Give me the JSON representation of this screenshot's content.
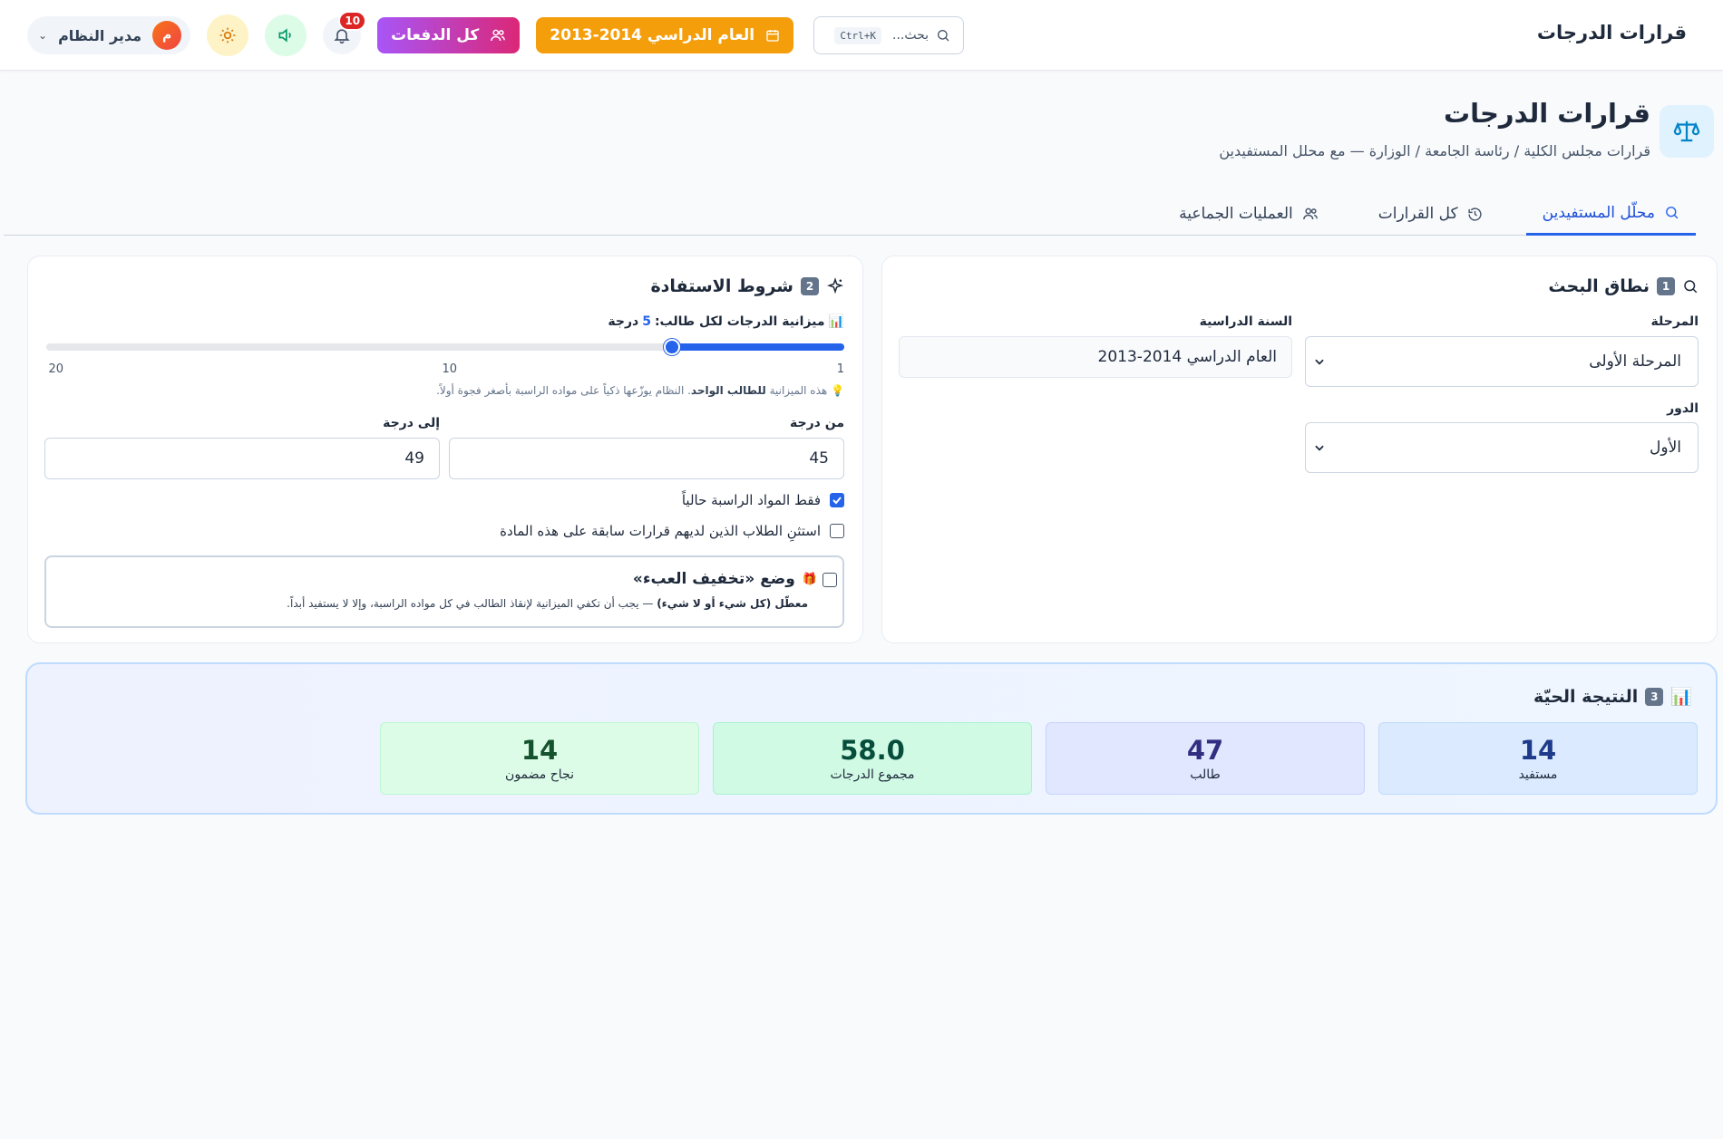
{
  "topbar": {
    "app_title": "قرارات الدرجات",
    "search_placeholder": "بحث...",
    "search_shortcut": "Ctrl+K",
    "year_pill": "العام الدراسي 2014-2013",
    "batches_pill": "كل الدفعات",
    "notifications_count": "10",
    "user_name": "مدير النظام",
    "user_initial": "م"
  },
  "page": {
    "title": "قرارات الدرجات",
    "subtitle": "قرارات مجلس الكلية / رئاسة الجامعة / الوزارة — مع محلل المستفيدين"
  },
  "tabs": [
    {
      "label": "محلّل المستفيدين",
      "icon": "search-icon",
      "active": true
    },
    {
      "label": "كل القرارات",
      "icon": "history-icon",
      "active": false
    },
    {
      "label": "العمليات الجماعية",
      "icon": "users-icon",
      "active": false
    }
  ],
  "scope": {
    "badge": "1",
    "title": "نطاق البحث",
    "stage_label": "المرحلة",
    "stage_value": "المرحلة الأولى",
    "year_label": "السنة الدراسية",
    "year_value": "العام الدراسي 2014-2013",
    "round_label": "الدور",
    "round_value": "الأول"
  },
  "conditions": {
    "badge": "2",
    "title": "شروط الاستفادة",
    "budget_label": "ميزانية الدرجات لكل طالب:",
    "budget_value": "5",
    "budget_unit": "درجة",
    "slider": {
      "min": 1,
      "max": 20,
      "value": 5
    },
    "tick_min": "1",
    "tick_mid": "10",
    "tick_max": "20",
    "hint_prefix": "هذه الميزانية",
    "hint_bold": "للطالب الواحد",
    "hint_suffix": ". النظام يوزّعها ذكياً على مواده الراسبة بأصغر فجوة أولاً.",
    "from_label": "من درجة",
    "from_value": "45",
    "to_label": "إلى درجة",
    "to_value": "49",
    "only_failing_label": "فقط المواد الراسبة حالياً",
    "only_failing_checked": true,
    "exclude_prior_label": "استثنِ الطلاب الذين لديهم قرارات سابقة على هذه المادة",
    "exclude_prior_checked": false,
    "mode_title": "وضع «تخفيف العبء»",
    "mode_badge": "🎁",
    "mode_desc_bold": "معطّل (كل شيء أو لا شيء)",
    "mode_desc_rest": " — يجب أن تكفي الميزانية لإنقاذ الطالب في كل مواده الراسبة، وإلا لا يستفيد أبداً.",
    "mode_checked": false
  },
  "live": {
    "badge": "3",
    "title": "النتيجة الحيّة",
    "stats": [
      {
        "value": "14",
        "label": "مستفيد"
      },
      {
        "value": "47",
        "label": "طالب"
      },
      {
        "value": "58.0",
        "label": "مجموع الدرجات"
      },
      {
        "value": "14",
        "label": "نجاح مضمون"
      }
    ]
  },
  "colors": {
    "primary": "#2563eb",
    "year_pill": "#f59e0b",
    "batches_pill": "#c026d3",
    "notification_badge": "#dc2626"
  }
}
